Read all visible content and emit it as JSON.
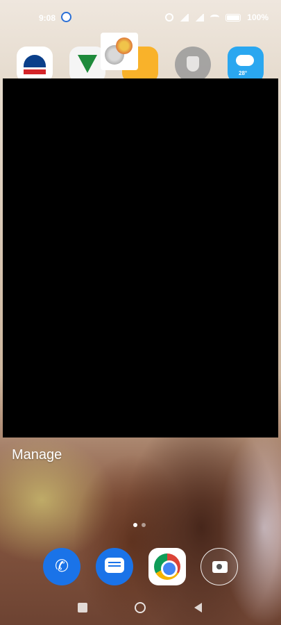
{
  "status_bar": {
    "time": "9:08",
    "battery": "100%"
  },
  "home_screen": {
    "top_row_apps": [
      {
        "icon": "bank-app-icon"
      },
      {
        "icon": "bank-app-green-icon"
      },
      {
        "icon": "file-manager-icon"
      },
      {
        "icon": "security-app-icon"
      },
      {
        "icon": "weather-app-icon",
        "temperature": "28°"
      }
    ],
    "dragged_item": {
      "icon": "widget-preview-icon"
    },
    "manage_label": "Manage",
    "page_indicator": {
      "pages": 2,
      "active": 1
    }
  },
  "dock": [
    {
      "icon": "phone-icon"
    },
    {
      "icon": "messages-icon"
    },
    {
      "icon": "chrome-icon"
    },
    {
      "icon": "camera-icon"
    }
  ],
  "navigation": {
    "buttons": [
      "recent-apps",
      "home",
      "back"
    ]
  },
  "colors": {
    "overlay": "#000000",
    "dock_blue": "#1a73e8",
    "text": "#ffffff"
  }
}
